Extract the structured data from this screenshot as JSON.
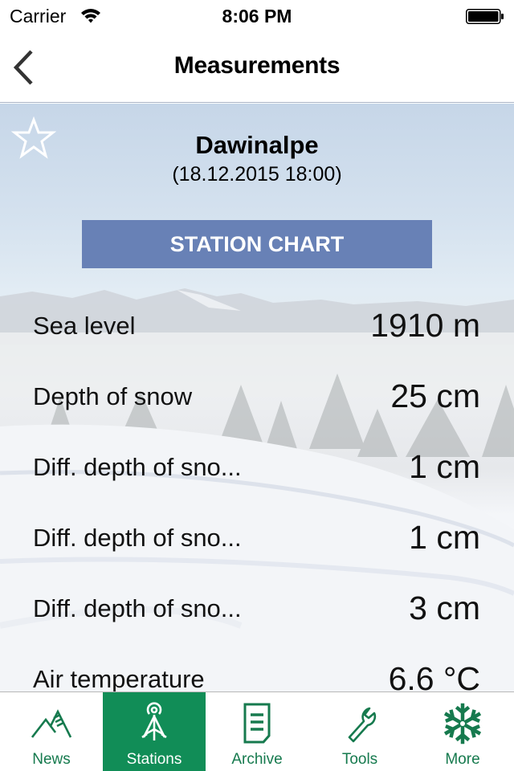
{
  "status_bar": {
    "carrier": "Carrier",
    "time": "8:06 PM",
    "icons": [
      "wifi-icon",
      "battery-icon"
    ]
  },
  "nav": {
    "title": "Measurements",
    "back_icon": "chevron-left-icon"
  },
  "station": {
    "favorite_icon": "star-outline-icon",
    "name": "Dawinalpe",
    "datetime": "(18.12.2015 18:00)",
    "chart_button_label": "STATION CHART"
  },
  "measurements": [
    {
      "label": "Sea level",
      "value": "1910 m"
    },
    {
      "label": "Depth of snow",
      "value": "25 cm"
    },
    {
      "label": "Diff. depth of sno...",
      "value": "1 cm"
    },
    {
      "label": "Diff. depth of sno...",
      "value": "1 cm"
    },
    {
      "label": "Diff. depth of sno...",
      "value": "3 cm"
    },
    {
      "label": "Air temperature",
      "value": "6.6 °C"
    }
  ],
  "tab_bar": {
    "active": "Stations",
    "tabs": [
      {
        "label": "News",
        "icon": "mountain-icon"
      },
      {
        "label": "Stations",
        "icon": "antenna-tower-icon"
      },
      {
        "label": "Archive",
        "icon": "document-icon"
      },
      {
        "label": "Tools",
        "icon": "wrench-icon"
      },
      {
        "label": "More",
        "icon": "snowflake-icon"
      }
    ]
  },
  "colors": {
    "accent_green": "#118d57",
    "tab_label_green": "#167a4e",
    "chart_button_blue": "#6881b6"
  }
}
